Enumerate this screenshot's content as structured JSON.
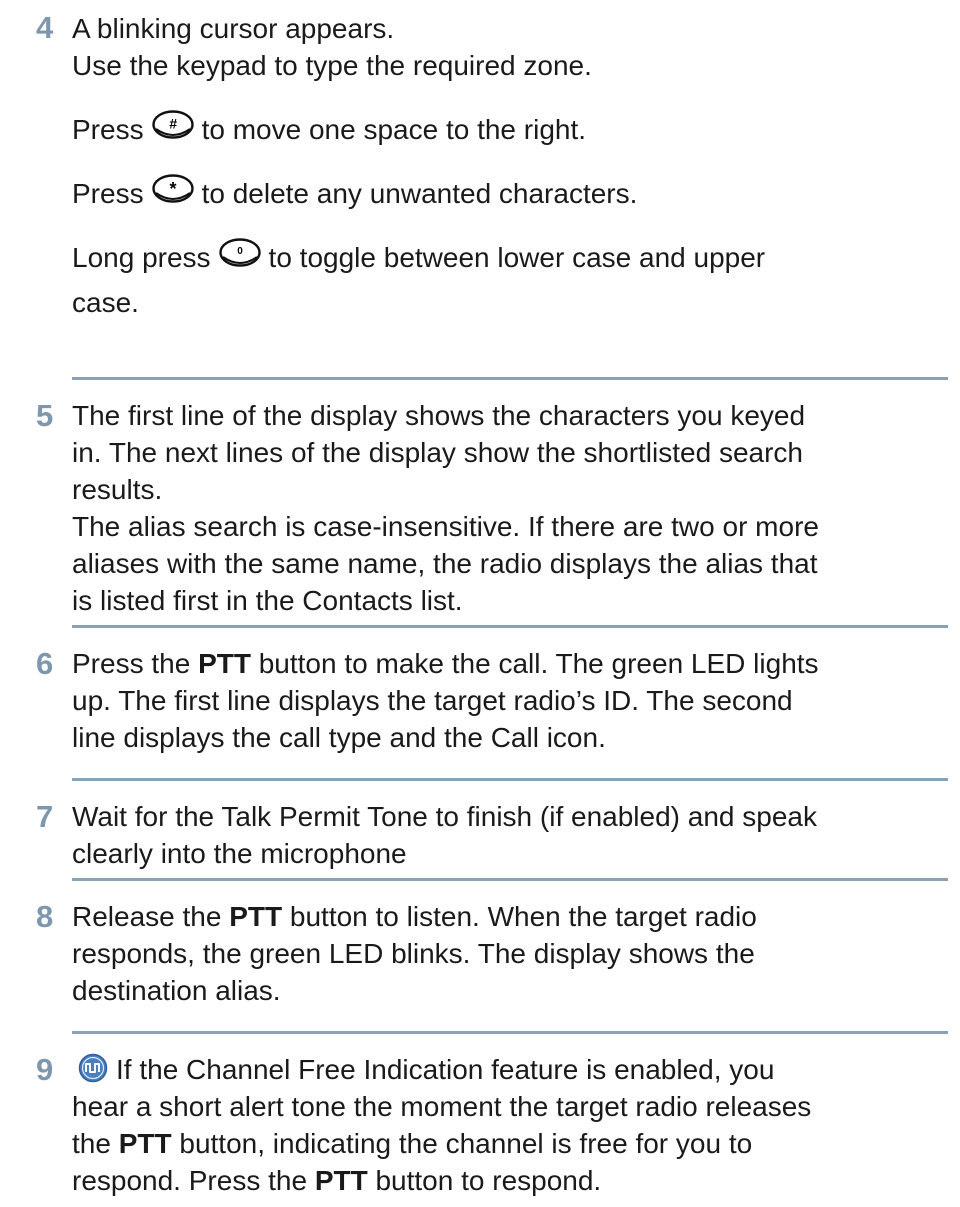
{
  "steps": [
    {
      "num": "4",
      "lines": [
        "A blinking cursor appears.",
        "Use the keypad to type the required zone."
      ],
      "hash": {
        "pre": "Press",
        "key": "#",
        "post": "to move one space to the right."
      },
      "star": {
        "pre": "Press",
        "key": "*",
        "post": "to delete any unwanted characters."
      },
      "zero": {
        "pre": "Long press",
        "key": "0",
        "post": "to toggle between lower case and upper",
        "post2": "case."
      }
    },
    {
      "num": "5",
      "lines": [
        "The first line of the display shows the characters you keyed",
        "in. The next lines of the display show the shortlisted search",
        "results.",
        "The alias search is case-insensitive. If there are two or more",
        "aliases with the same name, the radio displays the alias that",
        "is listed first in the Contacts list."
      ]
    },
    {
      "num": "6",
      "l1_pre": "Press the ",
      "l1_bold": "PTT",
      "l1_post": " button to make the call. The green LED lights",
      "l2": "up. The first line displays the target radio’s ID. The second",
      "l3": "line displays the call type and the Call icon."
    },
    {
      "num": "7",
      "l1": "Wait for the Talk Permit Tone to finish (if enabled) and speak",
      "l2": "clearly into the microphone"
    },
    {
      "num": "8",
      "l1_pre": "Release the ",
      "l1_bold": "PTT",
      "l1_post": " button to listen. When the target radio",
      "l2": "responds, the green LED blinks. The display shows the",
      "l3": "destination alias."
    },
    {
      "num": "9",
      "icon": "channel-free-indication-icon",
      "l1": "If the Channel Free Indication feature is enabled, you",
      "l2": "hear a short alert tone the moment the target radio releases",
      "l3_pre": "the ",
      "l3_bold": "PTT",
      "l3_post": " button, indicating the channel is free for you to",
      "l4_pre": "respond. Press the ",
      "l4_bold": "PTT",
      "l4_post": " button to respond."
    }
  ],
  "colors": {
    "number": "#7f97ad",
    "divider": "#8aa0b4",
    "icon": "#4a7fc0"
  }
}
